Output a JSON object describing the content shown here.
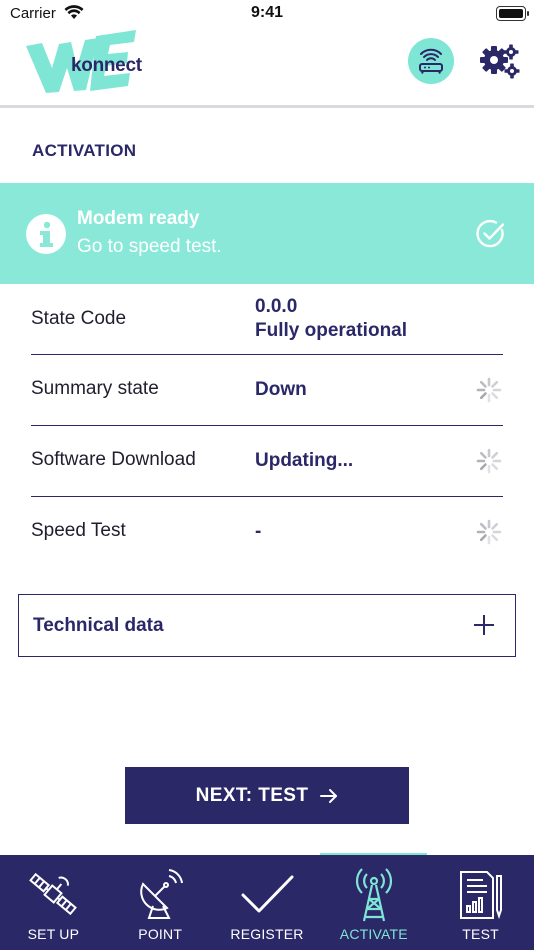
{
  "status_bar": {
    "carrier": "Carrier",
    "time": "9:41"
  },
  "header": {
    "logo_text": "konnect",
    "router_icon": "router-wifi-icon",
    "settings_icon": "gear-icon"
  },
  "section": {
    "title": "ACTIVATION"
  },
  "banner": {
    "title": "Modem ready",
    "subtitle": "Go to speed test.",
    "bg_color": "#89e8d8"
  },
  "rows": [
    {
      "label": "State Code",
      "value_line1": "0.0.0",
      "value_line2": "Fully operational"
    },
    {
      "label": "Summary state",
      "value": "Down"
    },
    {
      "label": "Software Download",
      "value": "Updating..."
    },
    {
      "label": "Speed Test",
      "value": "-"
    }
  ],
  "technical": {
    "label": "Technical data"
  },
  "next_button": {
    "label": "NEXT: TEST"
  },
  "tabs": [
    {
      "label": "SET UP",
      "icon": "satellite-icon"
    },
    {
      "label": "POINT",
      "icon": "satellite-dish-icon"
    },
    {
      "label": "REGISTER",
      "icon": "checkmark-icon"
    },
    {
      "label": "ACTIVATE",
      "icon": "antenna-tower-icon",
      "active": true
    },
    {
      "label": "TEST",
      "icon": "report-icon"
    }
  ],
  "colors": {
    "primary": "#2b2868",
    "accent": "#7fe6d6"
  }
}
